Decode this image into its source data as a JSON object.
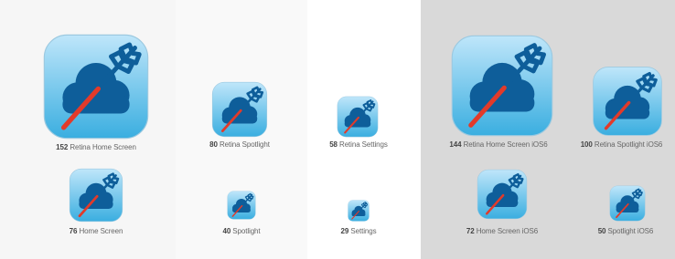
{
  "icons": [
    {
      "id": "152",
      "size": "152",
      "name": "Retina Home Screen"
    },
    {
      "id": "80",
      "size": "80",
      "name": "Retina Spotlight"
    },
    {
      "id": "58",
      "size": "58",
      "name": "Retina Settings"
    },
    {
      "id": "144",
      "size": "144",
      "name": "Retina Home Screen iOS6"
    },
    {
      "id": "100",
      "size": "100",
      "name": "Retina Spotlight iOS6"
    },
    {
      "id": "76",
      "size": "76",
      "name": "Home Screen"
    },
    {
      "id": "40",
      "size": "40",
      "name": "Spotlight"
    },
    {
      "id": "29",
      "size": "29",
      "name": "Settings"
    },
    {
      "id": "72",
      "size": "72",
      "name": "Home Screen iOS6"
    },
    {
      "id": "50",
      "size": "50",
      "name": "Spotlight iOS6"
    }
  ],
  "colors": {
    "icon_gradient_top": "#bfe6fa",
    "icon_gradient_bottom": "#3aaee0",
    "cloud": "#0e5e9a",
    "arrow_shaft": "#e23a2a",
    "arrow_fletching": "#0e5e9a"
  }
}
